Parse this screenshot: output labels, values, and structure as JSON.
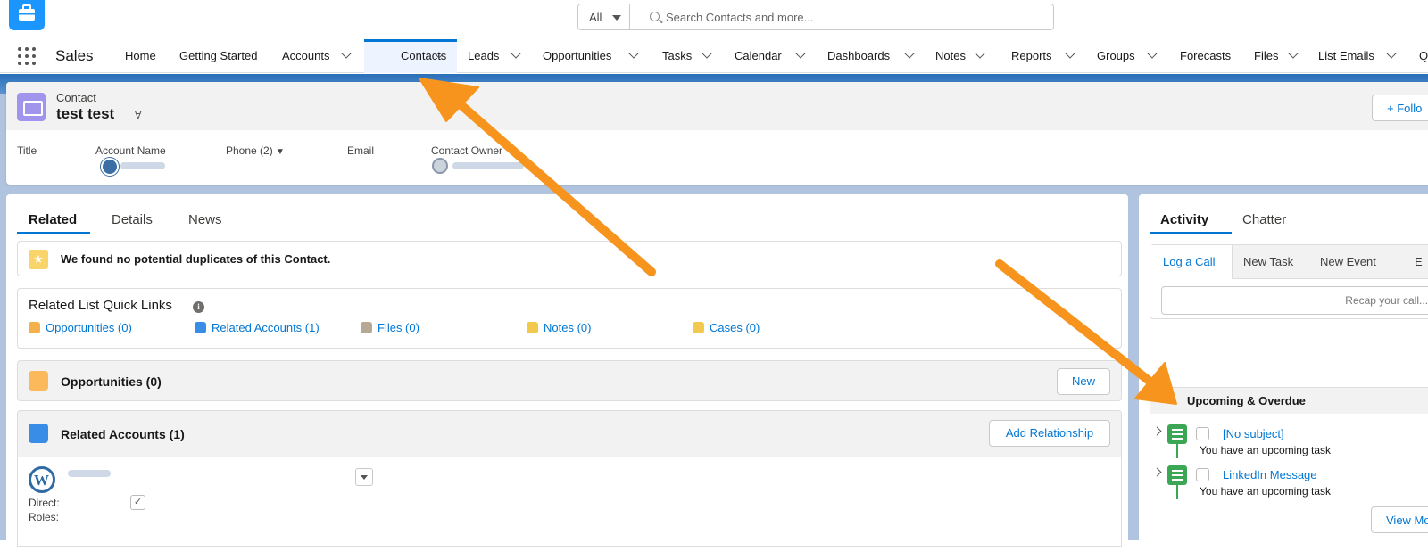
{
  "search": {
    "scope": "All",
    "placeholder": "Search Contacts and more..."
  },
  "app": {
    "name": "Sales"
  },
  "nav": [
    {
      "label": "Home"
    },
    {
      "label": "Getting Started"
    },
    {
      "label": "Accounts"
    },
    {
      "label": "Contacts"
    },
    {
      "label": "Leads"
    },
    {
      "label": "Opportunities"
    },
    {
      "label": "Tasks"
    },
    {
      "label": "Calendar"
    },
    {
      "label": "Dashboards"
    },
    {
      "label": "Notes"
    },
    {
      "label": "Reports"
    },
    {
      "label": "Groups"
    },
    {
      "label": "Forecasts"
    },
    {
      "label": "Files"
    },
    {
      "label": "List Emails"
    },
    {
      "label": "Q"
    }
  ],
  "record": {
    "type": "Contact",
    "name": "test test",
    "follow": "+ Follo",
    "fields": {
      "title": "Title",
      "account_name": "Account Name",
      "phone": "Phone (2)",
      "email": "Email",
      "owner": "Contact Owner"
    }
  },
  "left_tabs": {
    "related": "Related",
    "details": "Details",
    "news": "News"
  },
  "duplicates": {
    "text": "We found no potential duplicates of this Contact."
  },
  "quick_links": {
    "title": "Related List Quick Links",
    "info": "i",
    "items": [
      {
        "label": "Opportunities (0)",
        "color": "#f4b04a"
      },
      {
        "label": "Related Accounts (1)",
        "color": "#3a8de6"
      },
      {
        "label": "Files (0)",
        "color": "#b5a996"
      },
      {
        "label": "Notes (0)",
        "color": "#f2c94c"
      },
      {
        "label": "Cases (0)",
        "color": "#f2c94c"
      }
    ]
  },
  "opportunities": {
    "title": "Opportunities (0)",
    "new_button": "New"
  },
  "related_accounts": {
    "title": "Related Accounts (1)",
    "add_button": "Add Relationship",
    "direct_label": "Direct:",
    "roles_label": "Roles:",
    "direct_check": "✓"
  },
  "activity": {
    "tabs": {
      "activity": "Activity",
      "chatter": "Chatter"
    },
    "composer": {
      "log_call": "Log a Call",
      "new_task": "New Task",
      "new_event": "New Event",
      "more": "E",
      "recap_placeholder": "Recap your call..."
    },
    "upcoming_label": "Upcoming & Overdue",
    "items": [
      {
        "subject": "[No subject]",
        "sub": "You have an upcoming task"
      },
      {
        "subject": "LinkedIn Message",
        "sub": "You have an upcoming task"
      }
    ],
    "view_more": "View Mo"
  },
  "colors": {
    "accent": "#0176d3",
    "annotation_arrow": "#f7941d",
    "task_icon": "#3ba755",
    "contact_icon": "#a094ed"
  }
}
